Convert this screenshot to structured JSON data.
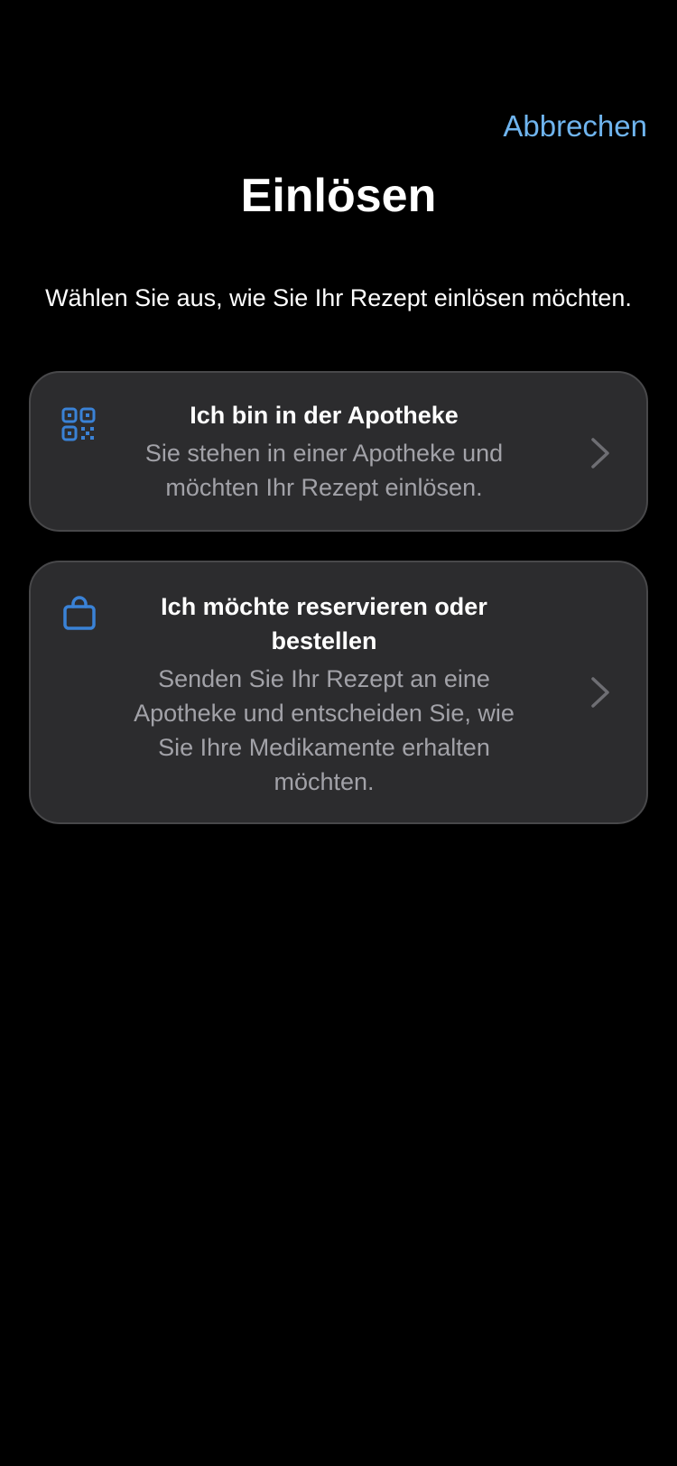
{
  "header": {
    "cancel_label": "Abbrechen",
    "title": "Einlösen",
    "subtitle": "Wählen Sie aus, wie Sie Ihr Rezept einlösen möchten."
  },
  "options": [
    {
      "icon": "qr-code-icon",
      "title": "Ich bin in der Apotheke",
      "description": "Sie stehen in einer Apotheke und möchten Ihr Rezept einlösen."
    },
    {
      "icon": "shopping-bag-icon",
      "title": "Ich möchte reservieren oder bestellen",
      "description": "Senden Sie Ihr Rezept an eine Apotheke und entscheiden Sie, wie Sie Ihre Medikamente erhalten möchten."
    }
  ],
  "colors": {
    "background": "#000000",
    "card": "#2c2c2e",
    "card_border": "#48484a",
    "accent_link": "#6fb4ee",
    "icon_blue": "#3a82d6",
    "secondary_text": "#a2a2a8",
    "chevron": "#6e6e73"
  }
}
